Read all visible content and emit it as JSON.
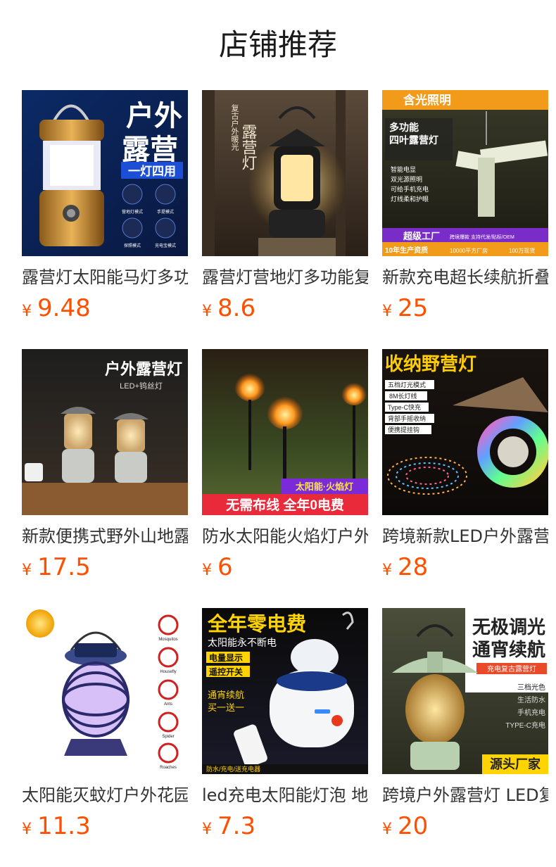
{
  "shop": {
    "title": "店铺推荐"
  },
  "products": [
    {
      "name": "露营灯太阳能马灯多功能户外露营灯",
      "currency": "¥",
      "price": "9.48",
      "image_text": [
        "户外",
        "露营",
        "一灯四用",
        "营地灯模式",
        "手提模式",
        "探照模式",
        "充电宝模式"
      ]
    },
    {
      "name": "露营灯营地灯多功能复古户外暖光露营灯",
      "currency": "¥",
      "price": "8.6",
      "image_text": [
        "复古户外暖光",
        "露营灯"
      ]
    },
    {
      "name": "新款充电超长续航折叠四叶露营灯",
      "currency": "¥",
      "price": "25",
      "image_text": [
        "含光照明",
        "多功能",
        "四叶露营灯",
        "智能电显",
        "双光源照明",
        "可给手机充电",
        "灯线柔和护眼",
        "超级工厂",
        "跨境爆款 支持代发/贴标/OEM",
        "10年生产资质",
        "10000平方厂房",
        "100万现货"
      ]
    },
    {
      "name": "新款便携式野外山地露营灯",
      "currency": "¥",
      "price": "17.5",
      "image_text": [
        "户外露营灯",
        "LED+钨丝灯"
      ]
    },
    {
      "name": "防水太阳能火焰灯户外花园灯",
      "currency": "¥",
      "price": "6",
      "image_text": [
        "太阳能·火焰灯",
        "无需布线 全年0电费"
      ]
    },
    {
      "name": "跨境新款LED户外露营灯带",
      "currency": "¥",
      "price": "28",
      "image_text": [
        "收纳野营灯",
        "五档灯光模式",
        "8M长灯线",
        "Type-C快充",
        "背部手摇收纳",
        "便携提挂钩"
      ]
    },
    {
      "name": "太阳能灭蚊灯户外花园庭院灯",
      "currency": "¥",
      "price": "11.3",
      "image_text": [
        "Mosquitos",
        "Housefly",
        "Ants",
        "Spider",
        "Roaches"
      ]
    },
    {
      "name": "led充电太阳能灯泡 地摊灯",
      "currency": "¥",
      "price": "7.3",
      "image_text": [
        "全年零电费",
        "太阳能永不断电",
        "电量显示",
        "遥控开关",
        "通宵续航",
        "买一送一",
        "防水/充电/送充电器"
      ]
    },
    {
      "name": "跨境户外露营灯 LED复古马灯",
      "currency": "¥",
      "price": "20",
      "image_text": [
        "无极调光",
        "通宵续航",
        "充电复古露营灯",
        "三档光色",
        "生活防水",
        "手机充电",
        "TYPE-C充电",
        "源头厂家"
      ]
    }
  ],
  "colors": {
    "price": "#ff5000",
    "title": "#1a1a1a",
    "name": "#333333"
  }
}
